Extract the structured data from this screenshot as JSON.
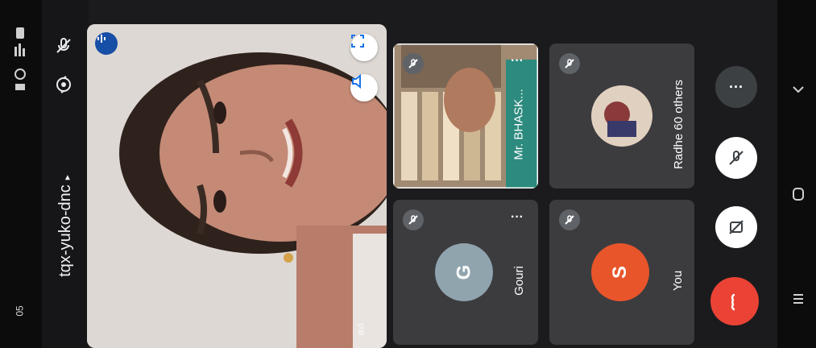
{
  "status_bar": {
    "time": "05"
  },
  "meeting": {
    "code": "tqx-yuko-dnc",
    "code_caret": "▸"
  },
  "main_video": {
    "speaker_label": "avi"
  },
  "tiles": [
    {
      "name": "Mr. BHASK...",
      "more": "···",
      "muted": true
    },
    {
      "name": "Radhe",
      "others_label": "60 others",
      "muted": true
    },
    {
      "name": "Gouri",
      "initial": "G",
      "avatar_color": "#90a4ae",
      "more": "···",
      "muted": true
    },
    {
      "name": "You",
      "initial": "S",
      "avatar_color": "#e8552b",
      "muted": true
    }
  ],
  "controls": {
    "more": "···",
    "end_call_color": "#ea4335"
  },
  "colors": {
    "background": "#1b1b1d",
    "tile": "#3c3c3f",
    "accent_blue": "#174ea6"
  },
  "icons": [
    "mic-off-icon",
    "camera-flip-icon",
    "fullscreen-icon",
    "speaker-icon",
    "audio-level-icon",
    "camera-off-icon",
    "end-call-icon",
    "more-icon",
    "chevron-down-icon",
    "home-icon",
    "recents-icon"
  ]
}
